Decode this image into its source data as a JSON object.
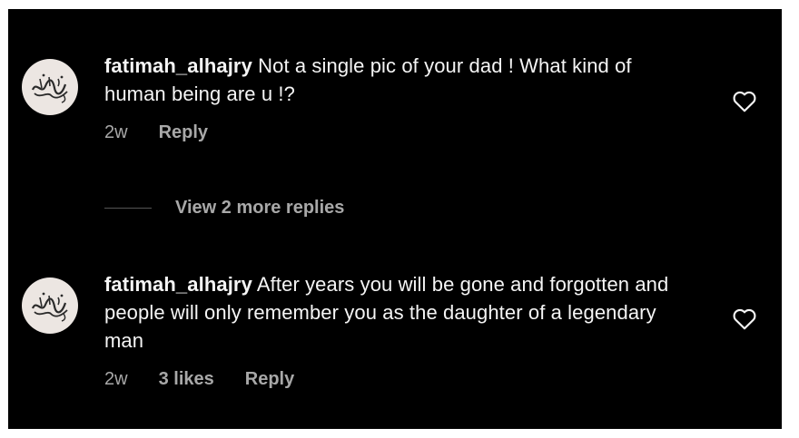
{
  "comments": [
    {
      "username": "fatimah_alhajry",
      "text": "Not a single pic of your dad ! What kind of human being are u !?",
      "time": "2w",
      "likes": "",
      "reply_label": "Reply",
      "avatar_icon": "calligraphy-avatar"
    },
    {
      "username": "fatimah_alhajry",
      "text": "After years you will be gone and forgotten and people will only remember you as the daughter of a legendary man",
      "time": "2w",
      "likes": "3 likes",
      "reply_label": "Reply",
      "avatar_icon": "calligraphy-avatar"
    }
  ],
  "view_replies": {
    "label": "View 2 more replies"
  },
  "icons": {
    "like": "heart-outline-icon"
  },
  "colors": {
    "background": "#000000",
    "text": "#f5f5f5",
    "secondary": "#a8a8a8"
  }
}
